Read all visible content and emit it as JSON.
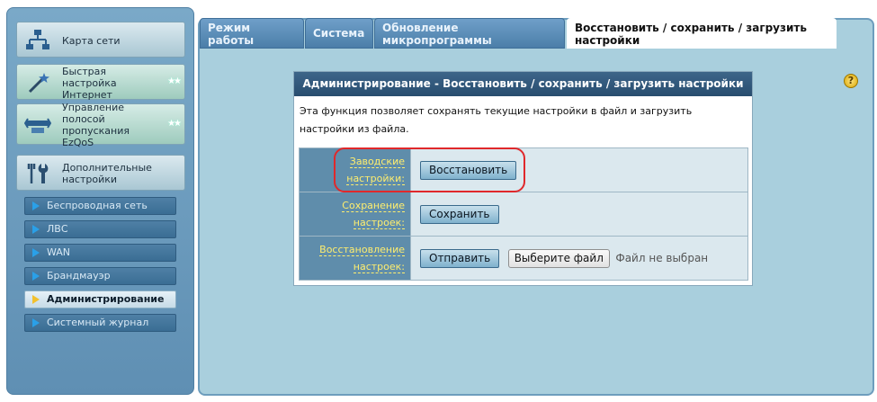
{
  "sidebar": {
    "big_items": [
      {
        "label": "Карта сети",
        "icon": "network-map-icon"
      },
      {
        "label": "Быстрая настройка Интернет",
        "icon": "magic-wand-icon"
      },
      {
        "label": "Управление полосой пропускания EzQoS",
        "icon": "bandwidth-icon"
      },
      {
        "label": "Дополнительные настройки",
        "icon": "tools-icon"
      }
    ],
    "sub_items": [
      {
        "label": "Беспроводная сеть"
      },
      {
        "label": "ЛВС"
      },
      {
        "label": "WAN"
      },
      {
        "label": "Брандмауэр"
      },
      {
        "label": "Администрирование",
        "active": true
      },
      {
        "label": "Системный журнал"
      }
    ]
  },
  "tabs": [
    {
      "label": "Режим работы"
    },
    {
      "label": "Система"
    },
    {
      "label": "Обновление микропрограммы"
    },
    {
      "label": "Восстановить / сохранить / загрузить настройки",
      "active": true
    }
  ],
  "help_icon": "?",
  "card": {
    "title": "Администрирование - Восстановить / сохранить / загрузить настройки",
    "description": "Эта функция позволяет сохранять текущие настройки в файл и загрузить настройки из файла.",
    "rows": [
      {
        "label": "Заводские настройки:",
        "button": "Восстановить"
      },
      {
        "label": "Сохранение настроек:",
        "button": "Сохранить"
      },
      {
        "label": "Восстановление настроек:",
        "button": "Отправить",
        "file_button": "Выберите файл",
        "file_status": "Файл не выбран"
      }
    ]
  },
  "colors": {
    "accent_yellow": "#ffee6e",
    "highlight_red": "#e0282b",
    "header_blue": "#284d6f",
    "panel_bg": "#a9cfdd"
  }
}
